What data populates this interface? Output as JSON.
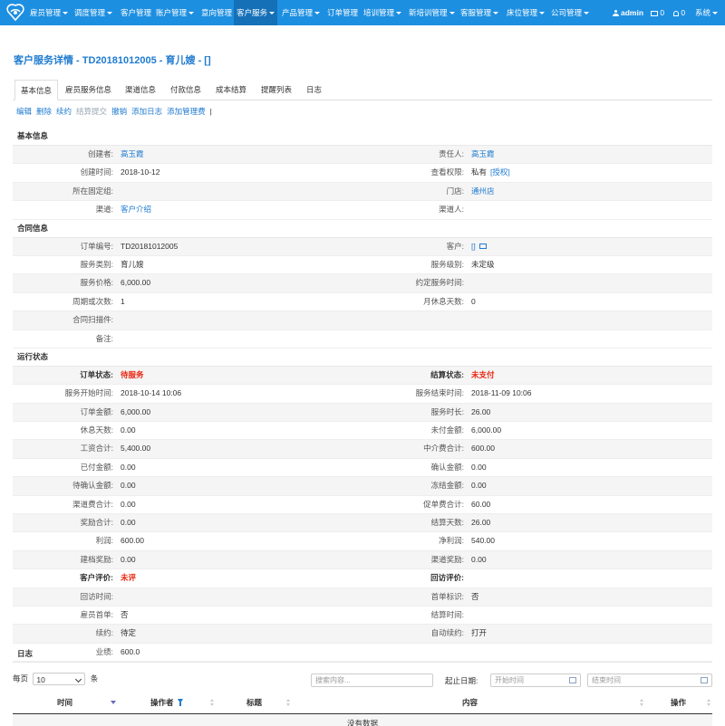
{
  "nav": {
    "items": [
      {
        "label": "雇员管理",
        "caret": true
      },
      {
        "label": "调度管理",
        "caret": true
      },
      {
        "label": "客户管理",
        "caret": false
      },
      {
        "label": "账户管理",
        "caret": true
      },
      {
        "label": "意向管理",
        "caret": false
      },
      {
        "label": "客户服务",
        "caret": true,
        "active": true
      },
      {
        "label": "产品管理",
        "caret": true
      },
      {
        "label": "订单管理",
        "caret": false
      },
      {
        "label": "培训管理",
        "caret": true
      },
      {
        "label": "新培训管理",
        "caret": true
      },
      {
        "label": "客服管理",
        "caret": true
      },
      {
        "label": "床位管理",
        "caret": true
      },
      {
        "label": "公司管理",
        "caret": true
      }
    ],
    "user": "admin",
    "mail_count": "0",
    "bell_count": "0",
    "system": "系统"
  },
  "page": {
    "title": "客户服务详情 - TD20181012005 - 育儿嫂 - []",
    "tabs": [
      "基本信息",
      "雇员服务信息",
      "渠道信息",
      "付款信息",
      "成本结算",
      "提醒列表",
      "日志"
    ],
    "actions": [
      {
        "label": "编辑",
        "enabled": true
      },
      {
        "label": "删除",
        "enabled": true
      },
      {
        "label": "续约",
        "enabled": true
      },
      {
        "label": "结算提交",
        "enabled": false
      },
      {
        "label": "撤销",
        "enabled": true
      },
      {
        "label": "添加日志",
        "enabled": true
      },
      {
        "label": "添加管理费",
        "enabled": true
      }
    ]
  },
  "sections": {
    "basic": {
      "title": "基本信息",
      "rows": [
        {
          "l1": "创建者:",
          "v1": "高玉霞",
          "v1link": true,
          "l2": "责任人:",
          "v2": "高玉霞",
          "v2link": true
        },
        {
          "l1": "创建时间:",
          "v1": "2018-10-12",
          "l2": "查看权限:",
          "v2": "私有",
          "v2extra": "[授权]"
        },
        {
          "l1": "所在固定组:",
          "v1": "",
          "l2": "门店:",
          "v2": "通州店",
          "v2link": true
        },
        {
          "l1": "渠道:",
          "v1": "客户介绍",
          "v1link": true,
          "l2": "渠道人:",
          "v2": ""
        }
      ]
    },
    "contract": {
      "title": "合同信息",
      "rows": [
        {
          "l1": "订单编号:",
          "v1": "TD20181012005",
          "l2": "客户:",
          "v2": "[]",
          "v2link": true,
          "v2mail": true
        },
        {
          "l1": "服务类别:",
          "v1": "育儿嫂",
          "l2": "服务级别:",
          "v2": "未定级"
        },
        {
          "l1": "服务价格:",
          "v1": "6,000.00",
          "l2": "约定服务时间:",
          "v2": ""
        },
        {
          "l1": "周期或次数:",
          "v1": "1",
          "l2": "月休息天数:",
          "v2": "0"
        },
        {
          "l1": "合同扫描件:",
          "v1": "",
          "full": true
        },
        {
          "l1": "备注:",
          "v1": "",
          "full": true
        }
      ]
    },
    "status": {
      "title": "运行状态",
      "rows": [
        {
          "l1": "订单状态:",
          "v1": "待服务",
          "b1": true,
          "r1": true,
          "l2": "结算状态:",
          "v2": "未支付",
          "b2": true,
          "r2": true
        },
        {
          "l1": "服务开始时间:",
          "v1": "2018-10-14 10:06",
          "l2": "服务结束时间:",
          "v2": "2018-11-09 10:06"
        },
        {
          "l1": "订单金额:",
          "v1": "6,000.00",
          "l2": "服务时长:",
          "v2": "26.00"
        },
        {
          "l1": "休息天数:",
          "v1": "0.00",
          "l2": "未付金额:",
          "v2": "6,000.00"
        },
        {
          "l1": "工资合计:",
          "v1": "5,400.00",
          "l2": "中介费合计:",
          "v2": "600.00"
        },
        {
          "l1": "已付金额:",
          "v1": "0.00",
          "l2": "确认金额:",
          "v2": "0.00"
        },
        {
          "l1": "待确认金额:",
          "v1": "0.00",
          "l2": "冻结金额:",
          "v2": "0.00"
        },
        {
          "l1": "渠道费合计:",
          "v1": "0.00",
          "l2": "促单费合计:",
          "v2": "60.00"
        },
        {
          "l1": "奖励合计:",
          "v1": "0.00",
          "l2": "结算天数:",
          "v2": "26.00"
        },
        {
          "l1": "利润:",
          "v1": "600.00",
          "l2": "净利润:",
          "v2": "540.00"
        },
        {
          "l1": "建档奖励:",
          "v1": "0.00",
          "l2": "渠道奖励:",
          "v2": "0.00"
        },
        {
          "l1": "客户评价:",
          "v1": "未评",
          "b1": true,
          "r1": true,
          "l2": "回访评价:",
          "v2": "",
          "b2": true
        },
        {
          "l1": "回访时间:",
          "v1": "",
          "l2": "首单标识:",
          "v2": "否"
        },
        {
          "l1": "雇员首单:",
          "v1": "否",
          "l2": "结算时间:",
          "v2": ""
        },
        {
          "l1": "续约:",
          "v1": "待定",
          "l2": "自动续约:",
          "v2": "打开"
        },
        {
          "l1": "业绩:",
          "v1": "600.0",
          "full": true
        }
      ]
    }
  },
  "log": {
    "title": "日志",
    "per_page_prefix": "每页",
    "per_page_value": "10",
    "per_page_suffix": "条",
    "search_placeholder": "搜索内容...",
    "range_label": "起止日期:",
    "start_placeholder": "开始时间",
    "end_placeholder": "结束时间",
    "columns": [
      "时间",
      "操作者",
      "标题",
      "内容",
      "操作"
    ],
    "empty": "没有数据"
  }
}
